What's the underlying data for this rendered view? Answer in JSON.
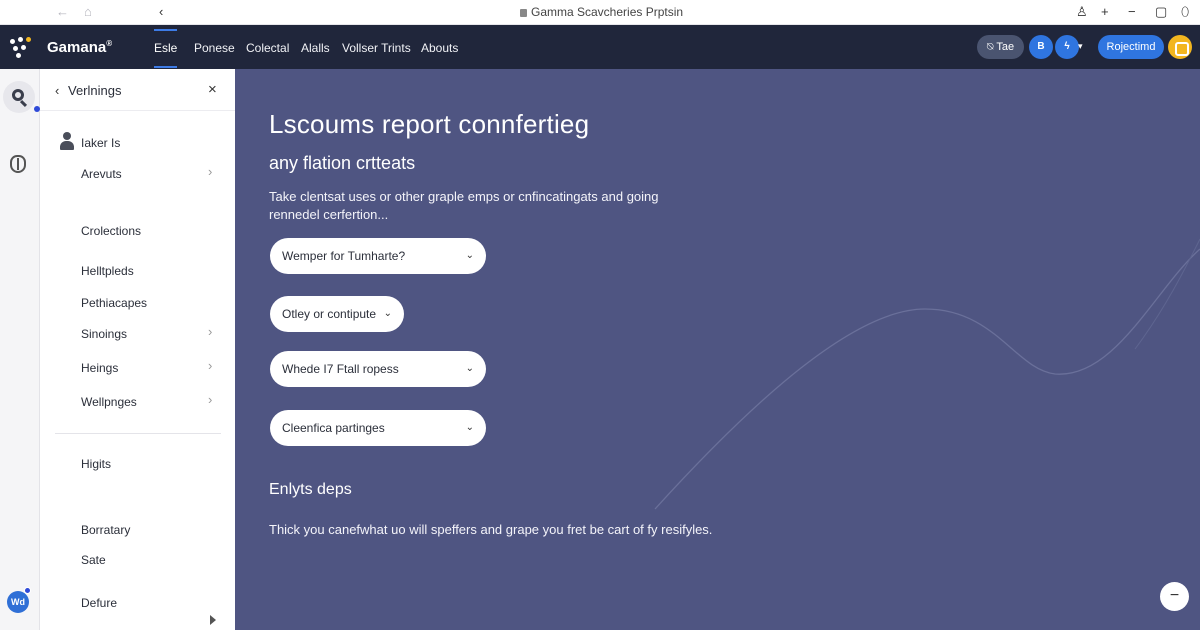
{
  "browser": {
    "title": "Gamma Scavcheries Prptsin",
    "back_icon": "arrow-left-icon",
    "home_icon": "home-icon",
    "nav_back_icon": "chevron-left-icon",
    "right_icons": [
      "person-icon",
      "plus-icon",
      "minus-icon",
      "restore-icon",
      "shield-outline-icon"
    ]
  },
  "topnav": {
    "brand": "Gamana",
    "brand_mark": "®",
    "items": [
      "Esle",
      "Ponese",
      "Colectal",
      "Alalls",
      "Vollser Trints",
      "Abouts"
    ],
    "active_index": 0,
    "tae_label": "Tae",
    "btn_b": "B",
    "btn_bolt": "ϟ",
    "cta_label": "Rojectimd",
    "colors": {
      "bg": "#20263b",
      "accent": "#2f75e0",
      "badge": "#f2b620"
    }
  },
  "rail": {
    "icons": [
      "search-icon",
      "shield-icon"
    ],
    "avatar_initials": "Wd"
  },
  "panel": {
    "back_glyph": "‹",
    "title": "Verlnings",
    "close_glyph": "×",
    "items": [
      {
        "label": "Iaker Is",
        "chevron": false
      },
      {
        "label": "Arevuts",
        "chevron": true
      },
      {
        "label": "Crolections",
        "chevron": false
      },
      {
        "label": "Helltpleds",
        "chevron": false
      },
      {
        "label": "Pethiacapes",
        "chevron": false
      },
      {
        "label": "Sinoings",
        "chevron": true
      },
      {
        "label": "Heings",
        "chevron": true
      },
      {
        "label": "Wellpnges",
        "chevron": true
      },
      {
        "label": "Higits",
        "chevron": false
      },
      {
        "label": "Borratary",
        "chevron": false
      },
      {
        "label": "Sate",
        "chevron": false
      },
      {
        "label": "Defure",
        "chevron": false
      }
    ]
  },
  "main": {
    "title": "Lscoums report  connfertieg",
    "subtitle": "any flation crtteats",
    "description": "Take clentsat uses or other graple emps or cnfincatingats and going rennedel cerfertion...",
    "selects": [
      "Wemper for Tumharte?",
      "Otley or contipute",
      "Whede I7 Ftall ropess",
      "Cleenfica partinges"
    ],
    "section_title": "Enlyts deps",
    "footer_text": "Thick you canefwhat uo will speffers and grape you fret be cart of fy resifyles.",
    "fab_glyph": "−",
    "colors": {
      "bg": "#4f5582"
    }
  }
}
